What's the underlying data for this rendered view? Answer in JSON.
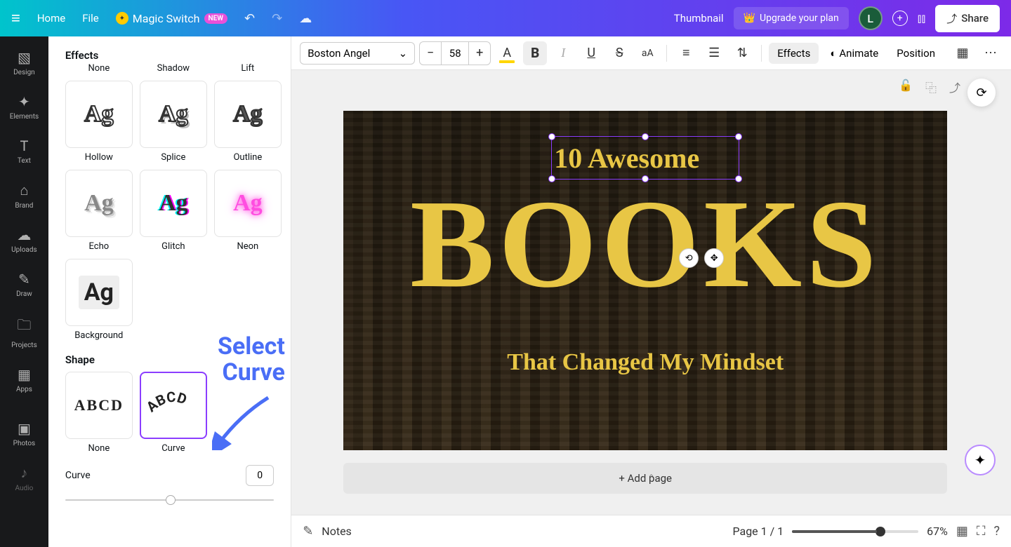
{
  "topbar": {
    "home": "Home",
    "file": "File",
    "magic_switch": "Magic Switch",
    "new_badge": "NEW",
    "doc_title": "Thumbnail",
    "upgrade": "Upgrade your plan",
    "avatar_initial": "L",
    "share": "Share"
  },
  "rail": [
    {
      "label": "Design",
      "icon": "▧"
    },
    {
      "label": "Elements",
      "icon": "✦"
    },
    {
      "label": "Text",
      "icon": "T"
    },
    {
      "label": "Brand",
      "icon": "⌂"
    },
    {
      "label": "Uploads",
      "icon": "☁"
    },
    {
      "label": "Draw",
      "icon": "✎"
    },
    {
      "label": "Projects",
      "icon": "🗀"
    },
    {
      "label": "Apps",
      "icon": "▦"
    },
    {
      "label": "Photos",
      "icon": "▣"
    },
    {
      "label": "Audio",
      "icon": "♪"
    }
  ],
  "panel": {
    "effects_title": "Effects",
    "effects_row0": [
      "None",
      "Shadow",
      "Lift"
    ],
    "effects": [
      "Hollow",
      "Splice",
      "Outline",
      "Echo",
      "Glitch",
      "Neon",
      "Background"
    ],
    "shape_title": "Shape",
    "shapes": [
      "None",
      "Curve"
    ],
    "curve_label": "Curve",
    "curve_value": "0"
  },
  "annotation": {
    "line1": "Select",
    "line2": "Curve"
  },
  "toolbar": {
    "font": "Boston Angel",
    "size": "58",
    "effects": "Effects",
    "animate": "Animate",
    "position": "Position"
  },
  "canvas": {
    "text1": "10 Awesome",
    "text2": "BOOKS",
    "text3": "That Changed My Mindset",
    "add_page": "+ Add page"
  },
  "bottombar": {
    "notes": "Notes",
    "page_indicator": "Page 1 / 1",
    "zoom": "67%"
  }
}
